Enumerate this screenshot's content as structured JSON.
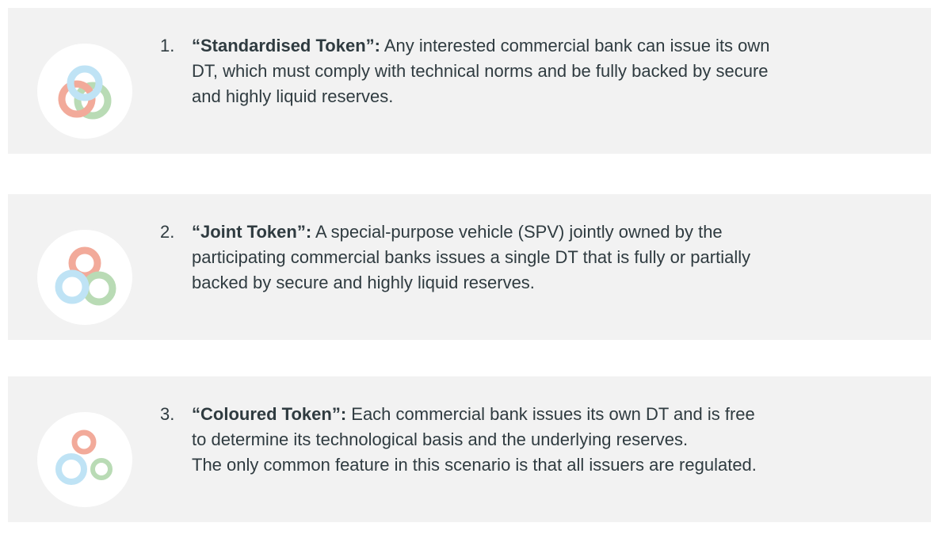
{
  "items": [
    {
      "number": "1.",
      "label": "“Standardised Token”:",
      "lines": [
        " Any interested commercial bank can issue its own",
        "DT, which must comply with technical norms and be fully backed by secure",
        "and highly liquid reserves."
      ],
      "icon": "three-interlinked-rings-icon"
    },
    {
      "number": "2.",
      "label": "“Joint Token”:",
      "lines": [
        " A special-purpose vehicle (SPV) jointly owned by the",
        "participating commercial banks issues a single DT that is fully or partially",
        "backed by secure and highly liquid reserves."
      ],
      "icon": "three-overlapping-rings-icon"
    },
    {
      "number": "3.",
      "label": "“Coloured Token”:",
      "lines": [
        " Each commercial bank issues its own DT and is free",
        "to determine its technological basis and the underlying reserves.",
        "The only common feature in this scenario is that all issuers are regulated."
      ],
      "icon": "three-separate-rings-icon"
    }
  ],
  "colors": {
    "card_background": "#f2f2f2",
    "ring_blue": "#bfe3f5",
    "ring_red": "#f2aa9a",
    "ring_green": "#b9dbb5",
    "text": "#2f3b40"
  }
}
